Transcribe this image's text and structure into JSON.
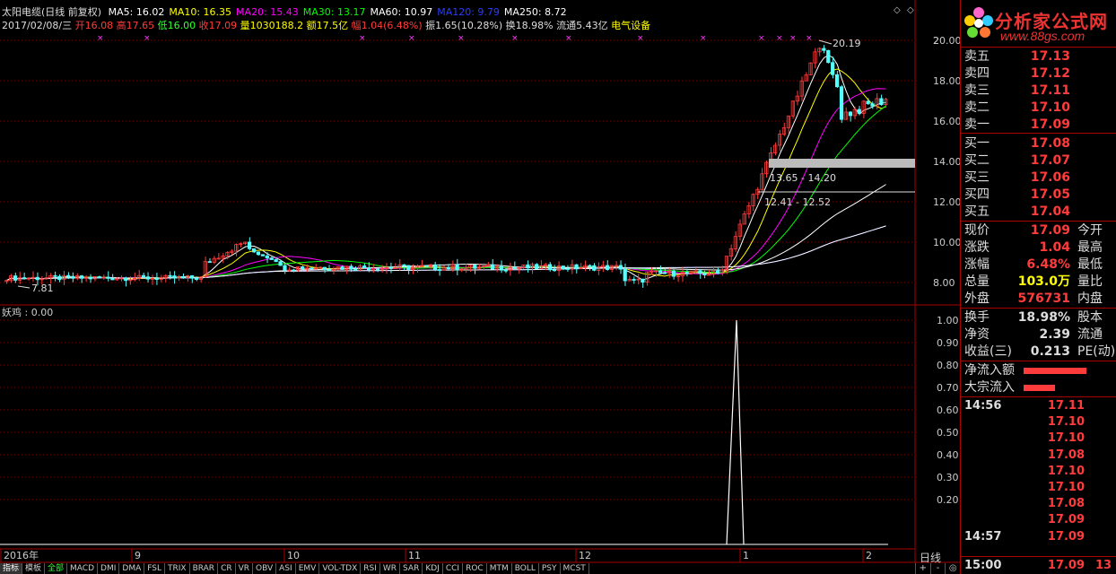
{
  "header": {
    "title": "太阳电缆(日线 前复权)",
    "ma": [
      {
        "label": "MA5:",
        "value": "16.02",
        "color": "#ffffff"
      },
      {
        "label": "MA10:",
        "value": "16.35",
        "color": "#ffff00"
      },
      {
        "label": "MA20:",
        "value": "15.43",
        "color": "#ff00ff"
      },
      {
        "label": "MA30:",
        "value": "13.17",
        "color": "#00ff00"
      },
      {
        "label": "MA60:",
        "value": "10.97",
        "color": "#ffffff"
      },
      {
        "label": "MA120:",
        "value": "9.79",
        "color": "#2a3cff"
      },
      {
        "label": "MA250:",
        "value": "8.72",
        "color": "#ffffff"
      }
    ],
    "date": "2017/02/08/三",
    "open_label": "开",
    "open": "16.08",
    "high_label": "高",
    "high": "17.65",
    "low_label": "低",
    "low": "16.00",
    "close_label": "收",
    "close": "17.09",
    "vol_label": "量",
    "vol": "1030188.2",
    "amt_label": "额",
    "amt": "17.5亿",
    "chg_label": "幅",
    "chg": "1.04(6.48%)",
    "amp_label": "振",
    "amp": "1.65(10.28%)",
    "turn_label": "换",
    "turn": "18.98%",
    "float_label": "流通",
    "float": "5.43亿",
    "sector": "电气设备"
  },
  "price_axis": [
    "20.00",
    "18.00",
    "16.00",
    "14.00",
    "12.00",
    "10.00",
    "8.00"
  ],
  "price_axis_top": "2",
  "annotations": {
    "high_mark": "20.19",
    "low_mark": "7.81",
    "zone1": "13.65 - 14.20",
    "zone2": "12.41 - 12.52"
  },
  "sub_chart": {
    "label": "妖鸡 : 0.00",
    "axis": [
      "1.00",
      "0.90",
      "0.80",
      "0.70",
      "0.60",
      "0.50",
      "0.40",
      "0.30",
      "0.20"
    ]
  },
  "time_axis": [
    "2016年",
    "9",
    "10",
    "11",
    "12",
    "1",
    "2"
  ],
  "period_label": "日线",
  "bottom_tabs": [
    "指标",
    "模板",
    "全部",
    "MACD",
    "DMI",
    "DMA",
    "FSL",
    "TRIX",
    "BRAR",
    "CR",
    "VR",
    "OBV",
    "ASI",
    "EMV",
    "VOL-TDX",
    "RSI",
    "WR",
    "SAR",
    "KDJ",
    "CCI",
    "ROC",
    "MTM",
    "BOLL",
    "PSY",
    "MCST"
  ],
  "right_tools": [
    "+",
    "-",
    "◎"
  ],
  "logo": {
    "text": "分析家公式网",
    "url": "www.88gs.com"
  },
  "order_book": {
    "asks": [
      {
        "label": "卖五",
        "price": "17.13"
      },
      {
        "label": "卖四",
        "price": "17.12"
      },
      {
        "label": "卖三",
        "price": "17.11"
      },
      {
        "label": "卖二",
        "price": "17.10"
      },
      {
        "label": "卖一",
        "price": "17.09"
      }
    ],
    "bids": [
      {
        "label": "买一",
        "price": "17.08"
      },
      {
        "label": "买二",
        "price": "17.07"
      },
      {
        "label": "买三",
        "price": "17.06"
      },
      {
        "label": "买四",
        "price": "17.05"
      },
      {
        "label": "买五",
        "price": "17.04"
      }
    ]
  },
  "stats": [
    {
      "label": "现价",
      "value": "17.09",
      "color": "red",
      "label2": "今开"
    },
    {
      "label": "涨跌",
      "value": "1.04",
      "color": "red",
      "label2": "最高"
    },
    {
      "label": "涨幅",
      "value": "6.48%",
      "color": "red",
      "label2": "最低"
    },
    {
      "label": "总量",
      "value": "103.0万",
      "color": "yellow",
      "label2": "量比"
    },
    {
      "label": "外盘",
      "value": "576731",
      "color": "red",
      "label2": "内盘"
    }
  ],
  "stats2": [
    {
      "label": "换手",
      "value": "18.98%",
      "label2": "股本"
    },
    {
      "label": "净资",
      "value": "2.39",
      "label2": "流通"
    },
    {
      "label": "收益(三)",
      "value": "0.213",
      "label2": "PE(动)"
    }
  ],
  "flows": [
    {
      "label": "净流入额",
      "fraction": 0.7
    },
    {
      "label": "大宗流入",
      "fraction": 0.35
    }
  ],
  "ticks": [
    {
      "time": "14:56",
      "price": "17.11"
    },
    {
      "time": "",
      "price": "17.10"
    },
    {
      "time": "",
      "price": "17.10"
    },
    {
      "time": "",
      "price": "17.08"
    },
    {
      "time": "",
      "price": "17.10"
    },
    {
      "time": "",
      "price": "17.10"
    },
    {
      "time": "",
      "price": "17.08"
    },
    {
      "time": "",
      "price": "17.09"
    },
    {
      "time": "14:57",
      "price": "17.09"
    },
    {
      "time": "15:00",
      "price": "17.09",
      "vol": "13"
    }
  ]
}
